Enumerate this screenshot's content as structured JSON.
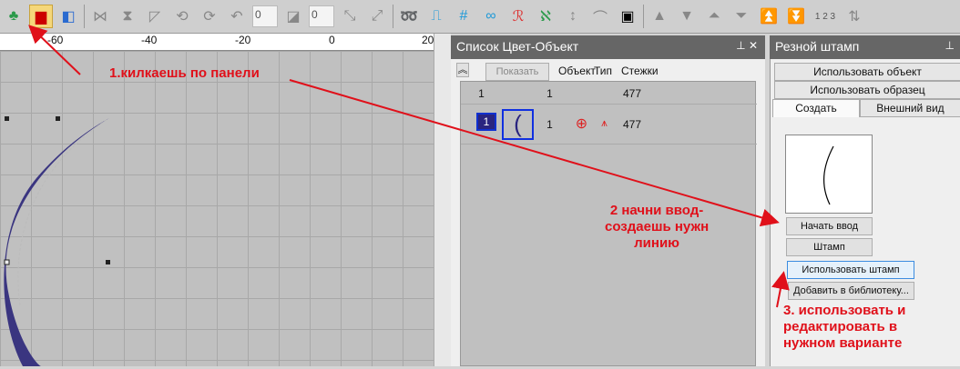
{
  "toolbar": {
    "field1": "0",
    "field2": "0",
    "numbering": "1 2 3"
  },
  "ruler": {
    "ticks": [
      "-60",
      "-40",
      "-20",
      "0",
      "20"
    ]
  },
  "color_panel": {
    "title": "Список Цвет-Объект",
    "show_button": "Показать",
    "columns": [
      "Объект",
      "Тип",
      "Стежки"
    ],
    "rows": [
      {
        "color": "1",
        "object": "1",
        "stitches": "477"
      },
      {
        "color": "1",
        "object": "1",
        "stitches": "477"
      }
    ]
  },
  "stamp_panel": {
    "title": "Резной штамп",
    "use_object": "Использовать объект",
    "use_sample": "Использовать образец",
    "tabs": [
      "Создать",
      "Внешний вид"
    ],
    "start_input": "Начать ввод",
    "stamp": "Штамп",
    "use_stamp": "Использовать штамп",
    "add_library": "Добавить в библиотеку..."
  },
  "annotations": {
    "step1": "1.килкаешь по панели",
    "step2": "2 начни ввод-\nсоздаешь нужн\nлинию",
    "step3": "3. использовать и\nредактировать в\nнужном варианте"
  },
  "colors": {
    "accent": "#e0101a",
    "thread": "#3a3580"
  }
}
